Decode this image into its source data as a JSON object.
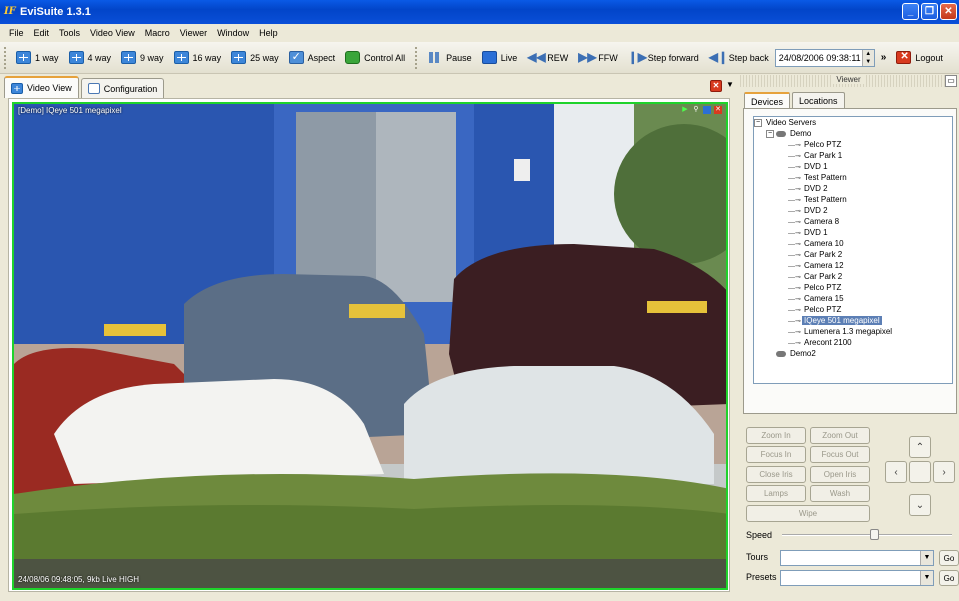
{
  "window": {
    "title": "EviSuite 1.3.1",
    "icon": "evisuite-logo-icon"
  },
  "menu": [
    "File",
    "Edit",
    "Tools",
    "Video View",
    "Macro",
    "Viewer",
    "Window",
    "Help"
  ],
  "toolbar": {
    "layouts": [
      "1 way",
      "4 way",
      "9 way",
      "16 way",
      "25 way"
    ],
    "aspect": "Aspect",
    "control_all": "Control All",
    "pause": "Pause",
    "live": "Live",
    "rew": "REW",
    "ffw": "FFW",
    "step_forward": "Step forward",
    "step_back": "Step back",
    "datetime": "24/08/2006 09:38:11",
    "overflow": "»",
    "logout": "Logout"
  },
  "tabs": [
    "Video View",
    "Configuration"
  ],
  "video": {
    "caption": "[Demo] IQeye 501 megapixel",
    "status": "24/08/06 09:48:05, 9kb Live HIGH",
    "border_color": "#1fd32b"
  },
  "viewer": {
    "title": "Viewer",
    "tabs": [
      "Devices",
      "Locations"
    ],
    "root": "Video Servers",
    "server": "Demo",
    "devices": [
      "Pelco PTZ",
      "Car Park 1",
      "DVD 1",
      "Test Pattern",
      "DVD 2",
      "Test Pattern",
      "DVD 2",
      "Camera 8",
      "DVD 1",
      "Camera 10",
      "Car Park 2",
      "Camera 12",
      "Car Park 2",
      "Pelco PTZ",
      "Camera 15",
      "Pelco PTZ",
      "IQeye 501 megapixel",
      "Lumenera 1.3 megapixel",
      "Arecont 2100"
    ],
    "selected_index": 16,
    "server2": "Demo2"
  },
  "ptz": {
    "zoom_in": "Zoom In",
    "zoom_out": "Zoom Out",
    "focus_in": "Focus In",
    "focus_out": "Focus Out",
    "close_iris": "Close Iris",
    "open_iris": "Open Iris",
    "lamps": "Lamps",
    "wash": "Wash",
    "wipe": "Wipe",
    "speed_label": "Speed",
    "speed_value": 0.55,
    "tours_label": "Tours",
    "presets_label": "Presets",
    "go": "Go"
  }
}
